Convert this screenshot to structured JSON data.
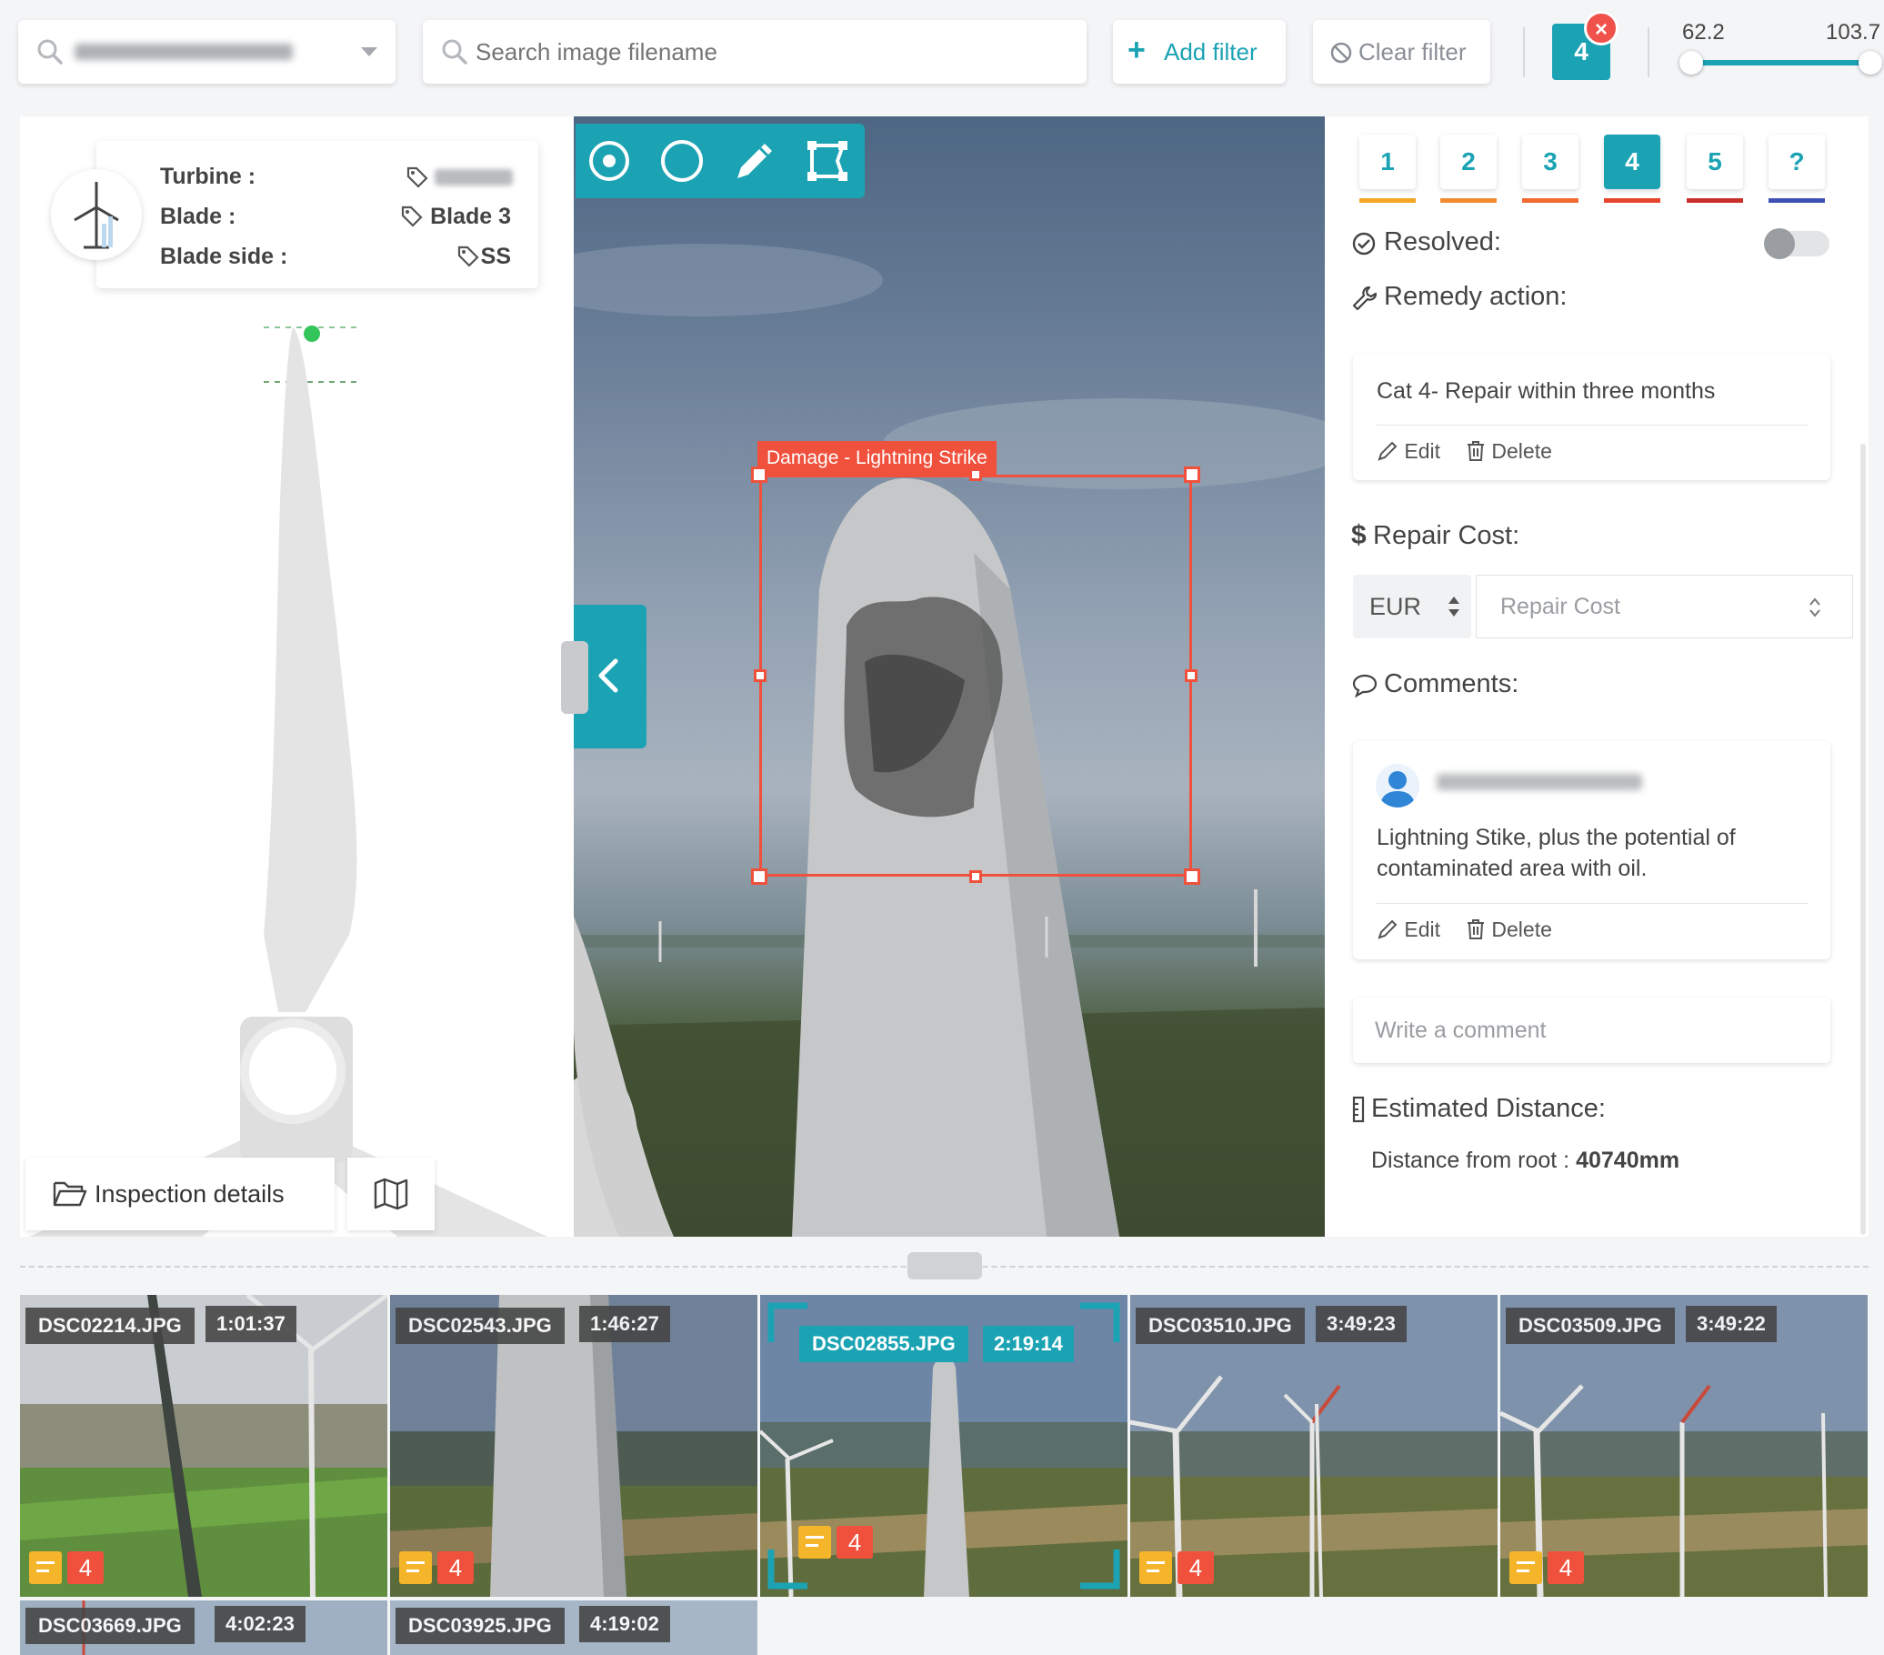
{
  "topbar": {
    "search_placeholder": "Search image filename",
    "add_filter_label": "Add filter",
    "clear_filter_label": "Clear filter",
    "filter_badge": "4",
    "slider_min": "62.2",
    "slider_max": "103.7"
  },
  "info": {
    "turbine_label": "Turbine :",
    "blade_label": "Blade :",
    "blade_value": "Blade 3",
    "blade_side_label": "Blade side :",
    "blade_side_value": "SS"
  },
  "left_actions": {
    "inspection_label": "Inspection details"
  },
  "image": {
    "annotation_label": "Damage - Lightning Strike"
  },
  "severity": {
    "tabs": [
      {
        "label": "1",
        "color": "#f5a623"
      },
      {
        "label": "2",
        "color": "#f28b30"
      },
      {
        "label": "3",
        "color": "#f06a32"
      },
      {
        "label": "4",
        "color": "#e8452e"
      },
      {
        "label": "5",
        "color": "#c9302c"
      },
      {
        "label": "?",
        "color": "#3f51b5"
      }
    ],
    "active": "4"
  },
  "details": {
    "resolved_label": "Resolved:",
    "remedy_label": "Remedy action:",
    "remedy_text": "Cat 4- Repair within three months",
    "edit_label": "Edit",
    "delete_label": "Delete",
    "repair_cost_label": "Repair Cost:",
    "currency": "EUR",
    "repair_cost_placeholder": "Repair Cost",
    "comments_label": "Comments:",
    "comment_text_1": "Lightning Stike, plus the potential of",
    "comment_text_2": "contaminated area with oil.",
    "write_comment_placeholder": "Write a comment",
    "distance_label": "Estimated Distance:",
    "distance_prefix": "Distance from root : ",
    "distance_value": "40740mm"
  },
  "thumbnails": [
    {
      "name": "DSC02214.JPG",
      "time": "1:01:37",
      "severity": "4"
    },
    {
      "name": "DSC02543.JPG",
      "time": "1:46:27",
      "severity": "4"
    },
    {
      "name": "DSC02855.JPG",
      "time": "2:19:14",
      "severity": "4",
      "selected": true
    },
    {
      "name": "DSC03510.JPG",
      "time": "3:49:23",
      "severity": "4"
    },
    {
      "name": "DSC03509.JPG",
      "time": "3:49:22",
      "severity": "4"
    },
    {
      "name": "DSC03669.JPG",
      "time": "4:02:23"
    },
    {
      "name": "DSC03925.JPG",
      "time": "4:19:02"
    }
  ],
  "colors": {
    "accent": "#1ba3b4",
    "danger": "#f0513c"
  }
}
